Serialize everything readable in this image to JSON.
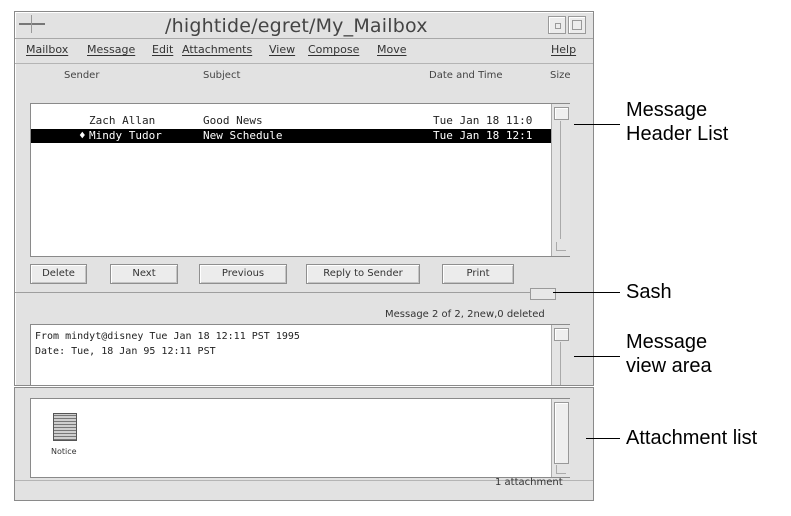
{
  "window": {
    "title": "/hightide/egret/My_Mailbox"
  },
  "menubar": {
    "items": [
      "Mailbox",
      "Message",
      "Edit",
      "Attachments",
      "View",
      "Compose",
      "Move",
      "Help"
    ]
  },
  "header_list": {
    "columns": [
      "Sender",
      "Subject",
      "Date and Time",
      "Size"
    ],
    "rows": [
      {
        "marker": "",
        "sender": "Zach Allan",
        "subject": "Good News",
        "date": "Tue Jan 18 11:0",
        "selected": false
      },
      {
        "marker": "♦",
        "sender": "Mindy Tudor",
        "subject": "New Schedule",
        "date": "Tue Jan 18 12:1",
        "selected": true
      }
    ]
  },
  "buttons": {
    "delete": "Delete",
    "next": "Next",
    "previous": "Previous",
    "reply": "Reply to Sender",
    "print": "Print"
  },
  "status": "Message 2 of 2, 2new,0 deleted",
  "message_view": {
    "lines": [
      "From mindyt@disney Tue Jan 18 12:11 PST 1995",
      "Date: Tue, 18 Jan 95 12:11 PST"
    ]
  },
  "attachments": {
    "items": [
      {
        "name": "Notice",
        "icon": "document-icon"
      }
    ],
    "status": "1 attachment"
  },
  "callouts": {
    "header_list": [
      "Message",
      "Header List"
    ],
    "sash": "Sash",
    "view_area": [
      "Message",
      "view area"
    ],
    "attachment_list": "Attachment list"
  },
  "colors": {
    "window_bg": "#e2e2e2",
    "selection_bg": "#000000",
    "selection_fg": "#ffffff"
  }
}
